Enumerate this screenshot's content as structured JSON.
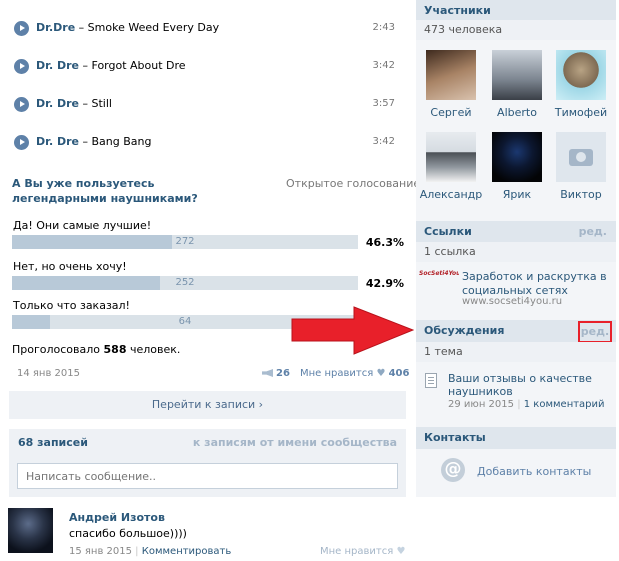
{
  "tracks": [
    {
      "artist": "Dr.Dre",
      "title": " – Smoke Weed Every Day",
      "duration": "2:43"
    },
    {
      "artist": "Dr. Dre",
      "title": " – Forgot About Dre",
      "duration": "3:42"
    },
    {
      "artist": "Dr. Dre",
      "title": " – Still",
      "duration": "3:57"
    },
    {
      "artist": "Dr. Dre",
      "title": " – Bang Bang",
      "duration": "3:42"
    }
  ],
  "poll": {
    "question": "А Вы уже пользуетесь легендарными наушниками?",
    "type": "Открытое голосование",
    "options": [
      {
        "label": "Да! Они самые лучшие!",
        "votes": "272",
        "percent": "46.3%",
        "fraction": 0.463
      },
      {
        "label": "Нет, но очень хочу!",
        "votes": "252",
        "percent": "42.9%",
        "fraction": 0.429
      },
      {
        "label": "Только что заказал!",
        "votes": "64",
        "percent": "",
        "fraction": 0.109
      }
    ],
    "total_prefix": "Проголосовало ",
    "total": "588",
    "total_suffix": " человек.",
    "date": "14 янв 2015",
    "reposts": "26",
    "like_label": "Мне нравится",
    "likes": "406",
    "go_button": "Перейти к записи"
  },
  "wall": {
    "count": "68 записей",
    "to_community": "к записям от имени сообщества",
    "placeholder": "Написать сообщение.."
  },
  "comment": {
    "author": "Андрей Изотов",
    "text": "спасибо большое))))",
    "date": "15 янв 2015",
    "reply": "Комментировать",
    "like": "Мне нравится"
  },
  "sidebar": {
    "members": {
      "title": "Участники",
      "count": "473 человека",
      "list": [
        "Сергей",
        "Alberto",
        "Тимофей",
        "Александр",
        "Ярик",
        "Виктор"
      ]
    },
    "links": {
      "title": "Ссылки",
      "edit": "ред.",
      "count": "1 ссылка",
      "item": {
        "logo_text": "SocSeti4You",
        "title": "Заработок и раскрутка в социальных сетях",
        "url": "www.socseti4you.ru"
      }
    },
    "discussions": {
      "title": "Обсуждения",
      "edit": "ред.",
      "count": "1 тема",
      "item": {
        "title": "Ваши отзывы о качестве наушников",
        "date": "29 июн 2015",
        "sep": "|",
        "comments": "1 комментарий"
      }
    },
    "contacts": {
      "title": "Контакты",
      "add": "Добавить контакты"
    }
  },
  "colors": {
    "link": "#2b587a",
    "header_bg": "#dfe6ed",
    "arrow": "#e8202a"
  }
}
